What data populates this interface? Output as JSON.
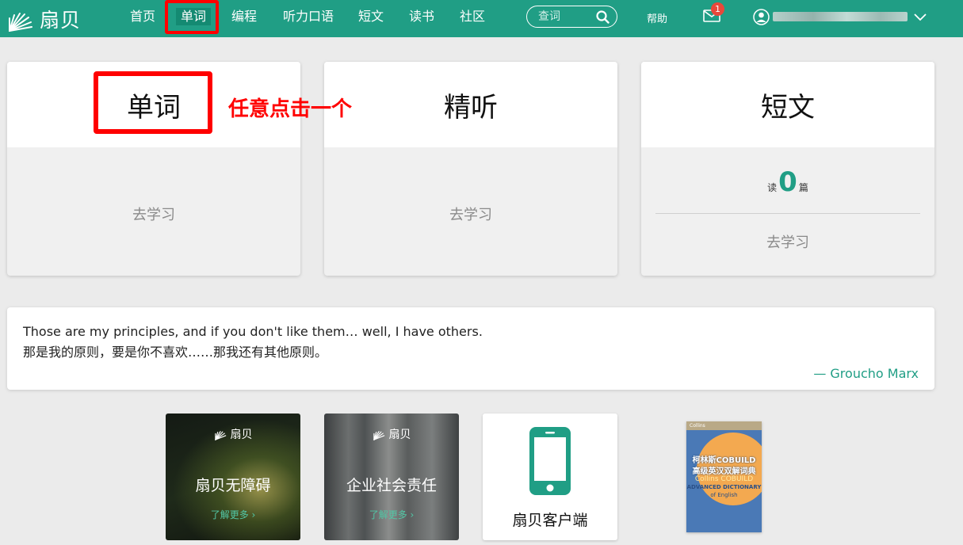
{
  "brand": {
    "name": "扇贝",
    "color": "#209e85"
  },
  "nav": {
    "items": [
      "首页",
      "单词",
      "编程",
      "听力口语",
      "短文",
      "读书",
      "社区"
    ],
    "active": "单词",
    "search_placeholder": "查词",
    "help": "帮助",
    "mail_badge": "1",
    "username": ""
  },
  "cards": [
    {
      "title": "单词",
      "link": "去学习"
    },
    {
      "title": "精听",
      "link": "去学习"
    },
    {
      "title": "短文",
      "read_prefix": "读",
      "read_count": "0",
      "read_suffix": "篇",
      "link": "去学习"
    }
  ],
  "annotation": "任意点击一个",
  "quote": {
    "en": "Those are my principles, and if you don't like them… well, I have others.",
    "zh": "那是我的原则，要是你不喜欢……那我还有其他原则。",
    "author": "— Groucho Marx"
  },
  "promos": [
    {
      "logo": "扇贝",
      "title": "扇贝无障碍",
      "more": "了解更多 ›"
    },
    {
      "logo": "扇贝",
      "title": "企业社会责任",
      "more": "了解更多 ›"
    },
    {
      "title": "扇贝客户端"
    }
  ],
  "book": {
    "brand": "Collins",
    "title_zh_1": "柯林斯COBUILD",
    "title_zh_2": "高级英汉双解词典",
    "title_en_1": "Collins COBUILD",
    "title_en_2": "ADVANCED DICTIONARY",
    "title_en_3": "of English"
  }
}
